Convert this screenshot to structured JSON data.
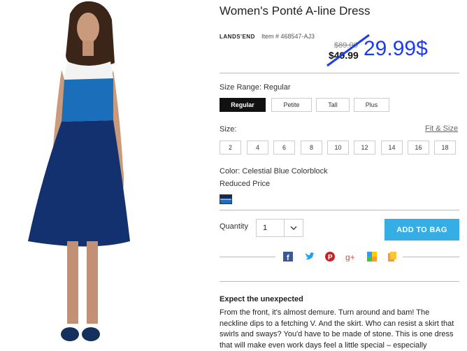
{
  "product": {
    "title": "Women's Ponté A-line Dress",
    "brand": "LANDS'END",
    "item_number": "Item # 468547-AJ3",
    "original_price": "$89.00",
    "sale_price": "$49.99",
    "overlay_price": "29.99$"
  },
  "size_range": {
    "label": "Size Range: Regular",
    "options": [
      "Regular",
      "Petite",
      "Tall",
      "Plus"
    ],
    "selected": "Regular"
  },
  "size": {
    "label": "Size:",
    "fit_link": "Fit & Size",
    "options": [
      "2",
      "4",
      "6",
      "8",
      "10",
      "12",
      "14",
      "16",
      "18"
    ]
  },
  "color": {
    "label": "Color: Celestial Blue Colorblock",
    "note": "Reduced Price"
  },
  "quantity": {
    "label": "Quantity",
    "value": "1"
  },
  "add_to_bag": "ADD TO BAG",
  "share_icons": [
    "facebook-icon",
    "twitter-icon",
    "pinterest-icon",
    "google-plus-icon",
    "delicious-icon",
    "bookmark-icon"
  ],
  "description": {
    "heading": "Expect the unexpected",
    "text": "From the front, it's almost demure. Turn around and bam! The neckline dips to a fetching V. And the skirt. Who can resist a skirt that swirls and sways? You'd have to be made of stone. This is one dress that will make even work days feel a little special – especially"
  },
  "colors": {
    "accent": "#35aee6",
    "overlay": "#1d3cf0",
    "dress_navy": "#13316e",
    "dress_blue": "#1b6fba"
  }
}
